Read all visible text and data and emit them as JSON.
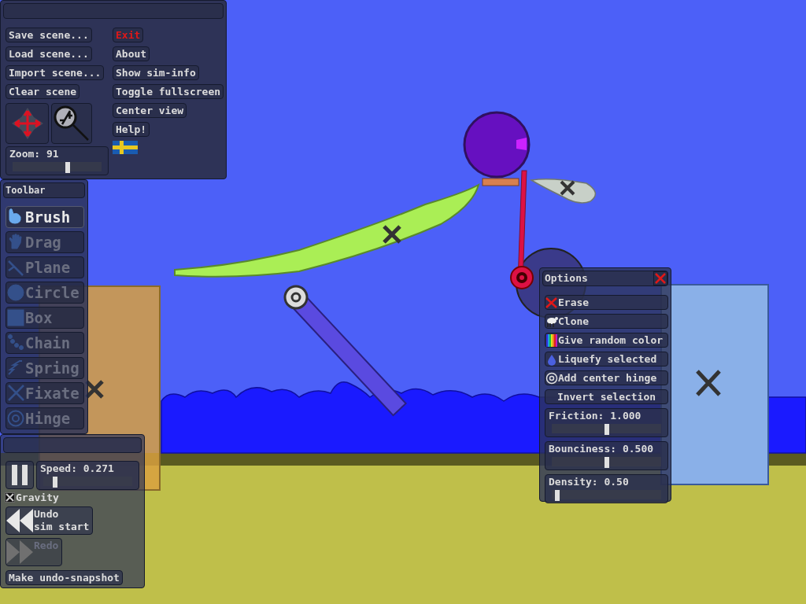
{
  "main_menu": {
    "left_buttons": [
      "Save scene...",
      "Load scene...",
      "Import scene...",
      "Clear scene"
    ],
    "right_buttons": [
      {
        "label": "Exit",
        "kind": "danger"
      },
      {
        "label": "About",
        "kind": "normal"
      },
      {
        "label": "Show sim-info",
        "kind": "normal"
      },
      {
        "label": "Toggle fullscreen",
        "kind": "normal"
      },
      {
        "label": "Center view",
        "kind": "normal"
      },
      {
        "label": "Help!",
        "kind": "normal"
      }
    ],
    "zoom": {
      "label": "Zoom: 91",
      "level": 0.62
    }
  },
  "toolbar": {
    "title": "Toolbar",
    "tools": [
      {
        "label": "Brush",
        "kind": "brush",
        "selected": true
      },
      {
        "label": "Drag",
        "kind": "drag",
        "selected": false
      },
      {
        "label": "Plane",
        "kind": "plane",
        "selected": false
      },
      {
        "label": "Circle",
        "kind": "circle",
        "selected": false
      },
      {
        "label": "Box",
        "kind": "box",
        "selected": false
      },
      {
        "label": "Chain",
        "kind": "chain",
        "selected": false
      },
      {
        "label": "Spring",
        "kind": "spring",
        "selected": false
      },
      {
        "label": "Fixate",
        "kind": "fixate",
        "selected": false
      },
      {
        "label": "Hinge",
        "kind": "hinge",
        "selected": false
      }
    ]
  },
  "sim_panel": {
    "speed": {
      "label": "Speed: 0.271",
      "level": 0.13
    },
    "gravity": {
      "label": "Gravity",
      "checked": true
    },
    "undo": {
      "lines": [
        "Undo",
        "sim start"
      ],
      "disabled": false
    },
    "redo": {
      "lines": [
        "Redo"
      ],
      "disabled": true
    },
    "snapshot": "Make undo-snapshot"
  },
  "options": {
    "title": "Options",
    "actions": [
      {
        "label": "Erase",
        "kind": "erase"
      },
      {
        "label": "Clone",
        "kind": "clone"
      },
      {
        "label": "Give random color",
        "kind": "color"
      },
      {
        "label": "Liquefy selected",
        "kind": "liquefy"
      },
      {
        "label": "Add center hinge",
        "kind": "hinge"
      },
      {
        "label": "Invert selection",
        "kind": "plain"
      }
    ],
    "sliders": [
      {
        "label": "Friction: 1.000",
        "level": 0.5
      },
      {
        "label": "Bounciness: 0.500",
        "level": 0.5
      },
      {
        "label": "Density: 0.50",
        "level": 0.05
      }
    ]
  }
}
